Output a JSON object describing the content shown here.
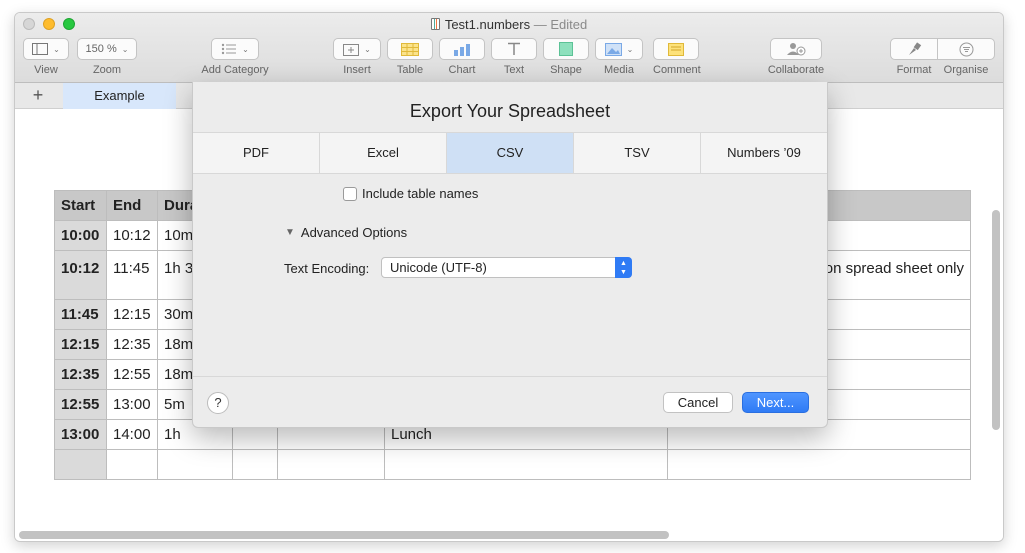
{
  "window": {
    "title": "Test1.numbers",
    "edited": "— Edited"
  },
  "toolbar": {
    "view": {
      "label": "View"
    },
    "zoom": {
      "label": "Zoom",
      "value": "150 %"
    },
    "add_category": {
      "label": "Add Category"
    },
    "insert": {
      "label": "Insert"
    },
    "table": {
      "label": "Table"
    },
    "chart": {
      "label": "Chart"
    },
    "text": {
      "label": "Text"
    },
    "shape": {
      "label": "Shape"
    },
    "media": {
      "label": "Media"
    },
    "comment": {
      "label": "Comment"
    },
    "collaborate": {
      "label": "Collaborate"
    },
    "format": {
      "label": "Format"
    },
    "organise": {
      "label": "Organise"
    }
  },
  "sheets": {
    "add": "+",
    "active": "Example"
  },
  "table": {
    "headers": [
      "Start",
      "End",
      "Dura",
      "",
      "",
      "",
      ""
    ],
    "rows": [
      [
        "10:00",
        "10:12",
        "10m",
        "",
        "",
        "",
        ""
      ],
      [
        "10:12",
        "11:45",
        "1h 3",
        "",
        "",
        "",
        "on spread sheet only"
      ],
      [
        "11:45",
        "12:15",
        "30m",
        "",
        "",
        "",
        ""
      ],
      [
        "12:15",
        "12:35",
        "18m",
        "",
        "",
        "",
        ""
      ],
      [
        "12:35",
        "12:55",
        "18m",
        "",
        "",
        "",
        ""
      ],
      [
        "12:55",
        "13:00",
        "5m",
        "",
        "",
        "",
        ""
      ],
      [
        "13:00",
        "14:00",
        "1h",
        "",
        "",
        "Lunch",
        ""
      ],
      [
        "",
        "",
        "",
        "",
        "",
        "",
        ""
      ]
    ]
  },
  "dialog": {
    "title": "Export Your Spreadsheet",
    "tabs": [
      "PDF",
      "Excel",
      "CSV",
      "TSV",
      "Numbers ’09"
    ],
    "active_tab": "CSV",
    "include_table_names": {
      "label": "Include table names",
      "checked": false
    },
    "advanced_options": "Advanced Options",
    "text_encoding": {
      "label": "Text Encoding:",
      "value": "Unicode (UTF-8)"
    },
    "help": "?",
    "cancel": "Cancel",
    "next": "Next..."
  },
  "colors": {
    "accent": "#2f7bf5",
    "active_tab": "#cfe0f5",
    "sheet_tab": "#d8e7fb"
  }
}
